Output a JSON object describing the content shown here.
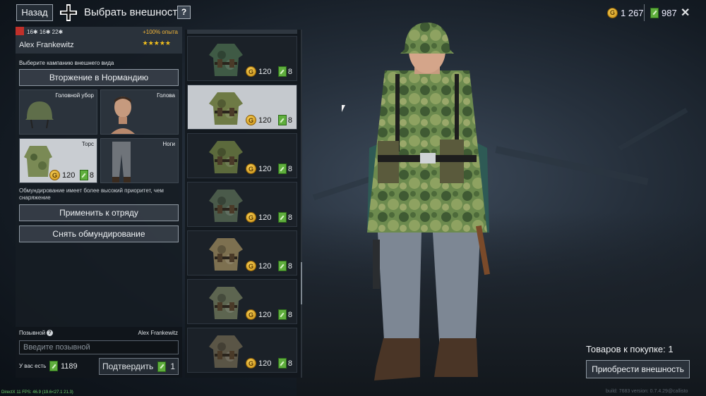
{
  "topbar": {
    "back_label": "Назад",
    "title": "Выбрать внешность",
    "help_label": "?",
    "gold": "1 267",
    "tickets": "987",
    "close_label": "✕"
  },
  "soldier": {
    "stats": "16✱ 16✱ 22✱",
    "bonus": "+100% опыта",
    "name": "Alex Frankewitz",
    "stars": "★★★★★"
  },
  "campaign": {
    "label": "Выберите кампанию внешнего вида",
    "value": "Вторжение в Нормандию"
  },
  "slots": [
    {
      "label": "Головной убор"
    },
    {
      "label": "Голова"
    },
    {
      "label": "Торс",
      "price": "120",
      "tickets": "8"
    },
    {
      "label": "Ноги"
    }
  ],
  "note": "Обмундирование имеет более высокий приоритет, чем снаряжение",
  "buttons": {
    "apply": "Применить к отряду",
    "remove": "Снять обмундирование"
  },
  "callsign": {
    "label": "Позывной",
    "help": "?",
    "current": "Alex Frankewitz",
    "placeholder": "Введите позывной",
    "have_label": "У вас есть",
    "have_value": "1189",
    "confirm_label": "Подтвердить",
    "confirm_cost": "1"
  },
  "items": [
    {
      "price": "120",
      "tickets": "8",
      "color": "#3f5a45"
    },
    {
      "price": "120",
      "tickets": "8",
      "color": "#6e7a45"
    },
    {
      "price": "120",
      "tickets": "8",
      "color": "#5c6a3c"
    },
    {
      "price": "120",
      "tickets": "8",
      "color": "#4a5a4a"
    },
    {
      "price": "120",
      "tickets": "8",
      "color": "#7d7050"
    },
    {
      "price": "120",
      "tickets": "8",
      "color": "#5d6550"
    },
    {
      "price": "120",
      "tickets": "8",
      "color": "#5a5546"
    }
  ],
  "purchase": {
    "count_text": "Товаров к покупке: 1",
    "buy_label": "Приобрести внешность"
  },
  "debug": {
    "fps": "DirectX 11 FPS: 46.9 (19.6<27.1 21.3)",
    "build": "build: 7683 version: 0.7.4.29@callisto"
  }
}
